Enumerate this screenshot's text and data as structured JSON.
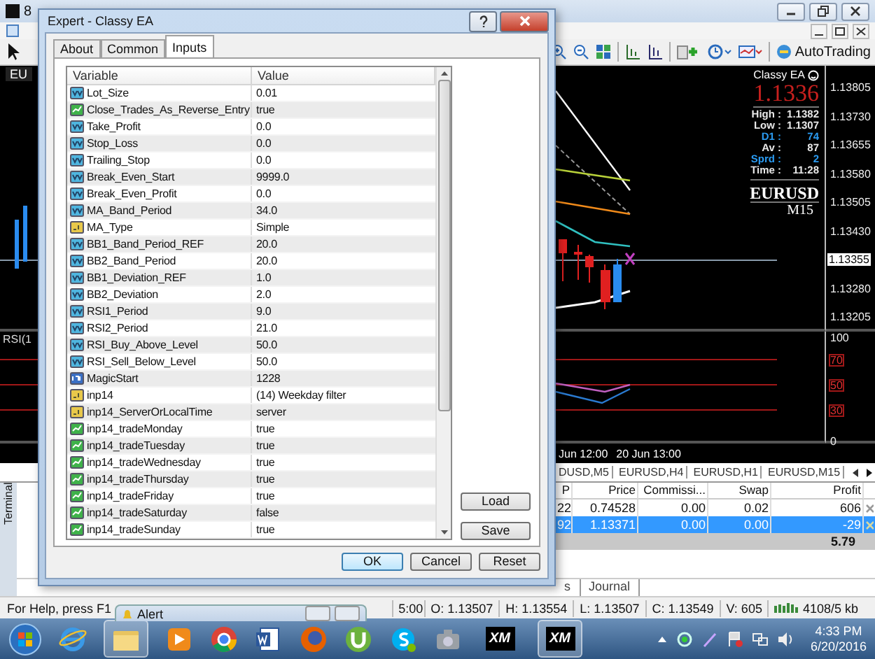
{
  "window": {
    "title": "8"
  },
  "toolbar": {
    "autotrading": "AutoTrading"
  },
  "chart": {
    "symbol_tab": "EU",
    "indicator_label": "RSI(1",
    "ea_name": "Classy EA",
    "price": "1.1336",
    "stats": [
      {
        "label": "High :",
        "value": "1.1382",
        "highlight": false
      },
      {
        "label": "Low :",
        "value": "1.1307",
        "highlight": false
      },
      {
        "label": "D1 :",
        "value": "74",
        "highlight": true
      },
      {
        "label": "Av :",
        "value": "87",
        "highlight": false
      },
      {
        "label": "Sprd :",
        "value": "2",
        "highlight": true
      },
      {
        "label": "Time :",
        "value": "11:28",
        "highlight": false
      }
    ],
    "symbol": "EURUSD",
    "timeframe": "M15",
    "price_axis": [
      {
        "label": "1.13805",
        "current": false
      },
      {
        "label": "1.13730",
        "current": false
      },
      {
        "label": "1.13655",
        "current": false
      },
      {
        "label": "1.13580",
        "current": false
      },
      {
        "label": "1.13505",
        "current": false
      },
      {
        "label": "1.13430",
        "current": false
      },
      {
        "label": "1.13355",
        "current": true
      },
      {
        "label": "1.13280",
        "current": false
      },
      {
        "label": "1.13205",
        "current": false
      }
    ],
    "rsi_axis": [
      {
        "label": "100",
        "kind": "plain"
      },
      {
        "label": "70",
        "kind": "level"
      },
      {
        "label": "50",
        "kind": "level"
      },
      {
        "label": "30",
        "kind": "level"
      },
      {
        "label": "0",
        "kind": "plain"
      }
    ],
    "time_axis": [
      "Jun 12:00",
      "20 Jun 13:00"
    ]
  },
  "chart_tabs": [
    {
      "label": "DUSD,M5",
      "selected": false
    },
    {
      "label": "EURUSD,H4",
      "selected": false
    },
    {
      "label": "EURUSD,H1",
      "selected": false
    },
    {
      "label": "EURUSD,M15",
      "selected": false
    }
  ],
  "terminal": {
    "label": "Terminal",
    "columns": [
      "P",
      "Price",
      "Commissi...",
      "Swap",
      "Profit"
    ],
    "rows": [
      {
        "cells": [
          "22",
          "0.74528",
          "0.00",
          "0.02",
          "606"
        ],
        "selected": false
      },
      {
        "cells": [
          "92",
          "1.13371",
          "0.00",
          "0.00",
          "-29"
        ],
        "selected": true
      }
    ],
    "total": "5.79",
    "tabs": [
      "s",
      "Journal"
    ]
  },
  "status_bar": {
    "help": "For Help, press F1",
    "fields": [
      "5:00",
      "O: 1.13507",
      "H: 1.13554",
      "L: 1.13507",
      "C: 1.13549",
      "V: 605"
    ],
    "traffic": "4108/5 kb"
  },
  "alert_window": {
    "title": "Alert"
  },
  "dialog": {
    "title": "Expert - Classy EA",
    "tabs": [
      {
        "label": "About",
        "selected": false
      },
      {
        "label": "Common",
        "selected": false
      },
      {
        "label": "Inputs",
        "selected": true
      }
    ],
    "columns": [
      "Variable",
      "Value"
    ],
    "inputs": [
      {
        "name": "Lot_Size",
        "value": "0.01",
        "kind": "double"
      },
      {
        "name": "Close_Trades_As_Reverse_Entry",
        "value": "true",
        "kind": "bool"
      },
      {
        "name": "Take_Profit",
        "value": "0.0",
        "kind": "double"
      },
      {
        "name": "Stop_Loss",
        "value": "0.0",
        "kind": "double"
      },
      {
        "name": "Trailing_Stop",
        "value": "0.0",
        "kind": "double"
      },
      {
        "name": "Break_Even_Start",
        "value": "9999.0",
        "kind": "double"
      },
      {
        "name": "Break_Even_Profit",
        "value": "0.0",
        "kind": "double"
      },
      {
        "name": "MA_Band_Period",
        "value": "34.0",
        "kind": "double"
      },
      {
        "name": "MA_Type",
        "value": "Simple",
        "kind": "string"
      },
      {
        "name": "BB1_Band_Period_REF",
        "value": "20.0",
        "kind": "double"
      },
      {
        "name": "BB2_Band_Period",
        "value": "20.0",
        "kind": "double"
      },
      {
        "name": "BB1_Deviation_REF",
        "value": "1.0",
        "kind": "double"
      },
      {
        "name": "BB2_Deviation",
        "value": "2.0",
        "kind": "double"
      },
      {
        "name": "RSI1_Period",
        "value": "9.0",
        "kind": "double"
      },
      {
        "name": "RSI2_Period",
        "value": "21.0",
        "kind": "double"
      },
      {
        "name": "RSI_Buy_Above_Level",
        "value": "50.0",
        "kind": "double"
      },
      {
        "name": "RSI_Sell_Below_Level",
        "value": "50.0",
        "kind": "double"
      },
      {
        "name": "MagicStart",
        "value": "1228",
        "kind": "int"
      },
      {
        "name": "inp14",
        "value": "(14) Weekday filter",
        "kind": "string"
      },
      {
        "name": "inp14_ServerOrLocalTime",
        "value": "server",
        "kind": "string"
      },
      {
        "name": "inp14_tradeMonday",
        "value": "true",
        "kind": "bool"
      },
      {
        "name": "inp14_tradeTuesday",
        "value": "true",
        "kind": "bool"
      },
      {
        "name": "inp14_tradeWednesday",
        "value": "true",
        "kind": "bool"
      },
      {
        "name": "inp14_tradeThursday",
        "value": "true",
        "kind": "bool"
      },
      {
        "name": "inp14_tradeFriday",
        "value": "true",
        "kind": "bool"
      },
      {
        "name": "inp14_tradeSaturday",
        "value": "false",
        "kind": "bool"
      },
      {
        "name": "inp14_tradeSunday",
        "value": "true",
        "kind": "bool"
      }
    ],
    "side_buttons": [
      "Load",
      "Save"
    ],
    "buttons": [
      {
        "label": "OK",
        "kind": "default"
      },
      {
        "label": "Cancel",
        "kind": "normal"
      },
      {
        "label": "Reset",
        "kind": "normal"
      }
    ]
  },
  "taskbar": {
    "xm_labels": [
      "XM",
      "XM"
    ],
    "time": "4:33 PM",
    "date": "6/20/2016"
  }
}
